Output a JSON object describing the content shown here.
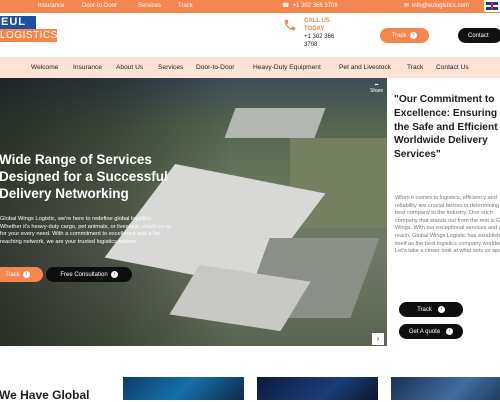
{
  "topbar": {
    "links": [
      "Insurance",
      "Door-to-Door",
      "Services",
      "Track"
    ],
    "phone": "+1 302 366 3708",
    "email": "info@eulogistics.com"
  },
  "header": {
    "logo_top": "EUL",
    "logo_bottom": "LOGISTICS",
    "call_label_1": "CALL US",
    "call_label_2": "TODAY",
    "call_number_1": "+1 302 366",
    "call_number_2": "3708",
    "track_button": "Track",
    "contact_button": "Contact",
    "language": "EN"
  },
  "nav": {
    "items": [
      "Welcome",
      "Insurance",
      "About Us",
      "Services",
      "Door-to-Door",
      "Heavy-Duty Equipment",
      "Pet and Livestock",
      "Track",
      "Contact Us"
    ]
  },
  "hero": {
    "title": "Wide Range of Services Designed for a Successful Delivery Networking",
    "text": "Global Wings Logistic, we're here to redefine global logistics. Whether it's heavy-duty cargo, pet animals, or livestock, count on us for your every need. With a commitment to excellence and a far-reaching network, we are your trusted logistics partner.",
    "track_button": "Track",
    "consult_button": "Free Consultation",
    "share_label": "Share"
  },
  "commitment": {
    "title": "\"Our Commitment to Excellence: Ensuring the Safe and Efficient Worldwide Delivery Services\"",
    "text": "When it comes to logistics, efficiency and reliability are crucial factors in determining the best company in the industry. One such company that stands out from the rest is Global Wings. With our exceptional services and global reach, Global Wings Logistic has established itself as the best logistics company worldwide. Let's take a closer look at what sets us apart.",
    "track_button": "Track",
    "quote_button": "Get A quote"
  },
  "bottom": {
    "title": "We Have Global"
  },
  "colors": {
    "accent": "#f4864f",
    "brand_blue": "#1f4fa3",
    "nav_bg": "#fde3d6"
  }
}
